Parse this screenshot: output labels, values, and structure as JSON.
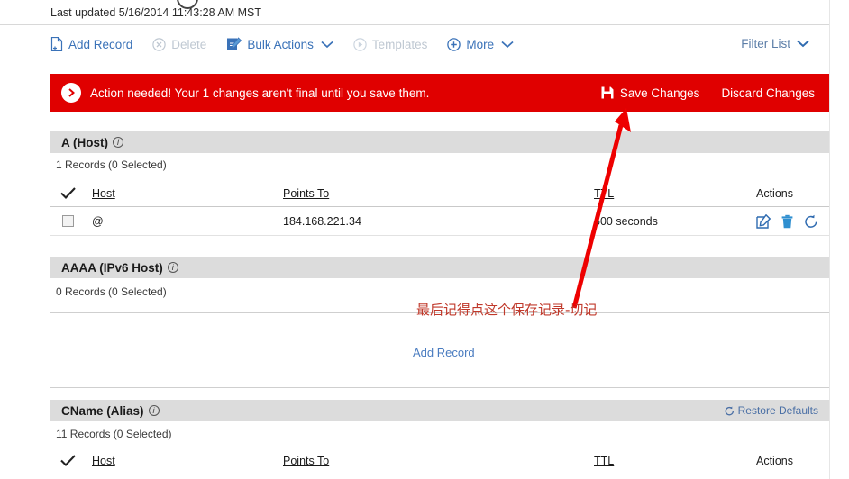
{
  "header": {
    "refresh_icon": "refresh-circle-icon",
    "last_updated": "Last updated 5/16/2014 11:43:28 AM MST"
  },
  "toolbar": {
    "items": [
      {
        "label": "Add Record",
        "icon": "add-file-icon",
        "disabled": false
      },
      {
        "label": "Delete",
        "icon": "delete-circle-icon",
        "disabled": true
      },
      {
        "label": "Bulk Actions",
        "icon": "bulk-actions-icon",
        "disabled": false,
        "caret": true
      },
      {
        "label": "Templates",
        "icon": "templates-circle-icon",
        "disabled": true
      },
      {
        "label": "More",
        "icon": "plus-circle-icon",
        "disabled": false,
        "caret": true
      }
    ],
    "filter_label": "Filter List",
    "filter_caret_icon": "chevron-down-icon",
    "link_color": "#3a72b8",
    "disabled_color": "#bfc8d2"
  },
  "alert": {
    "icon": "chevron-right-circle-icon",
    "message": "Action needed! Your 1 changes aren't final until you save them.",
    "save_label": "Save Changes",
    "save_icon": "save-floppy-icon",
    "discard_label": "Discard Changes",
    "bg_color": "#e00000",
    "text_color": "#ffffff"
  },
  "sections": [
    {
      "title": "A (Host)",
      "info_icon": "info-icon",
      "records_text": "1 Records (0 Selected)",
      "columns": {
        "check_icon": "checkmark-icon",
        "host": "Host",
        "points_to": "Points To",
        "ttl": "TTL",
        "actions": "Actions"
      },
      "rows": [
        {
          "host": "@",
          "points_to": "184.168.221.34",
          "ttl": "600 seconds",
          "actions": [
            "edit-icon",
            "trash-icon",
            "undo-icon"
          ]
        }
      ]
    },
    {
      "title": "AAAA (IPv6 Host)",
      "info_icon": "info-icon",
      "records_text": "0 Records (0 Selected)",
      "add_record_label": "Add Record",
      "rows": []
    },
    {
      "title": "CName (Alias)",
      "info_icon": "info-icon",
      "restore_defaults_label": "Restore Defaults",
      "restore_defaults_icon": "restore-refresh-icon",
      "records_text": "11 Records (0 Selected)",
      "columns": {
        "check_icon": "checkmark-icon",
        "host": "Host",
        "points_to": "Points To",
        "ttl": "TTL",
        "actions": "Actions"
      },
      "rows": []
    }
  ],
  "annotations": {
    "arrow_icon": "red-arrow-icon",
    "arrow_color": "#ee0000",
    "note_text": "最后记得点这个保存记录-切记",
    "note_color": "#c0392b"
  }
}
